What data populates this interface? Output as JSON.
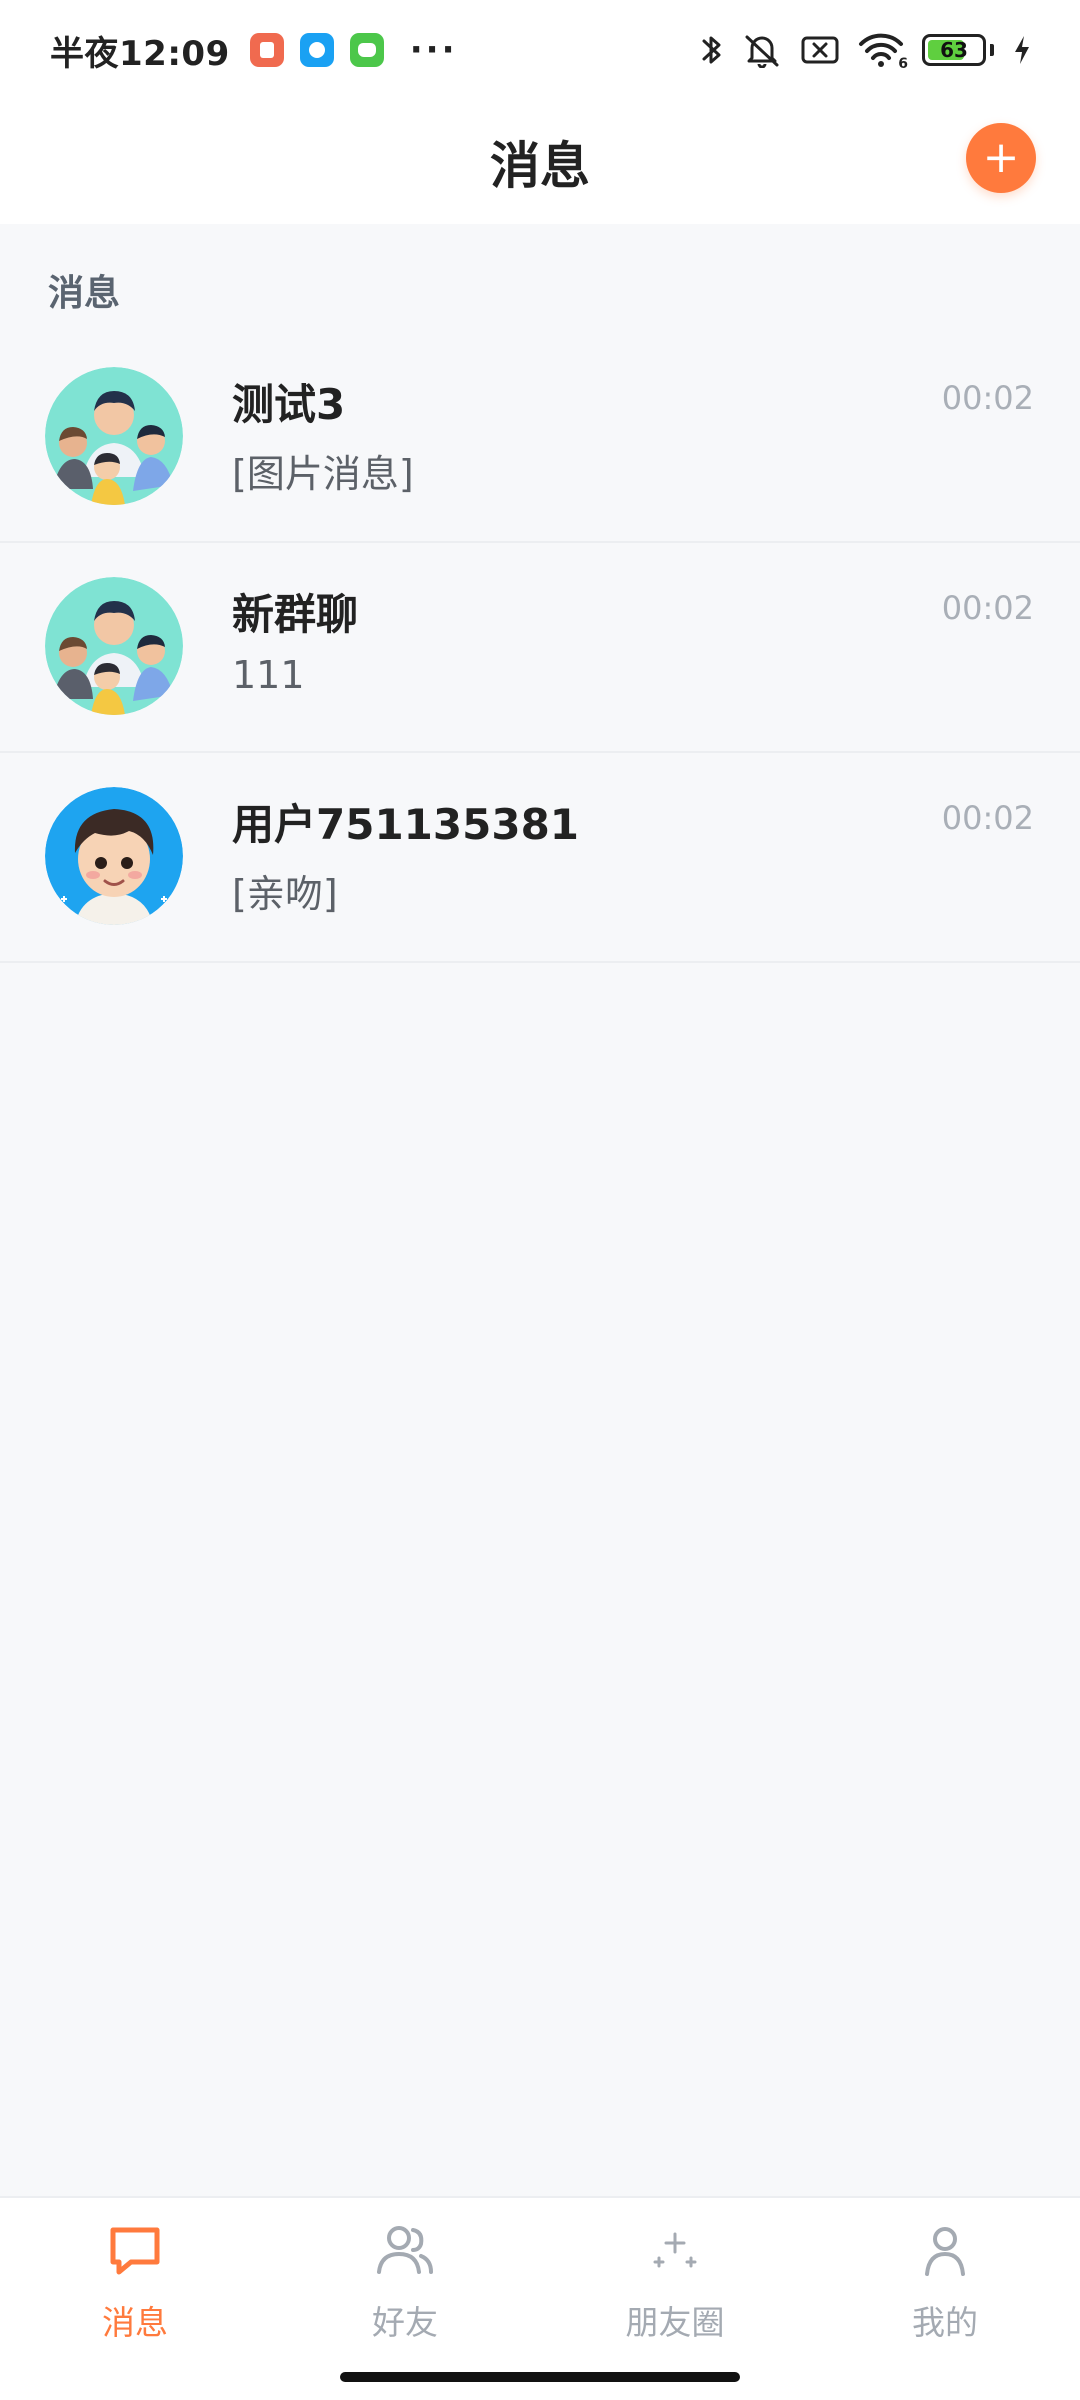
{
  "status_bar": {
    "time": "半夜12:09",
    "more": "···",
    "battery_level": "63",
    "wifi_badge": "6"
  },
  "header": {
    "title": "消息",
    "add_label": "+"
  },
  "section": {
    "label": "消息"
  },
  "conversations": [
    {
      "name": "测试3",
      "preview": "[图片消息]",
      "time": "00:02",
      "avatar_icon": "group-avatar-icon"
    },
    {
      "name": "新群聊",
      "preview": "111",
      "time": "00:02",
      "avatar_icon": "group-avatar-icon"
    },
    {
      "name": "用户751135381",
      "preview": "[亲吻]",
      "time": "00:02",
      "avatar_icon": "user-avatar-icon"
    }
  ],
  "tabbar": {
    "tabs": [
      {
        "label": "消息",
        "icon": "chat-bubble-icon",
        "active": true
      },
      {
        "label": "好友",
        "icon": "friends-icon",
        "active": false
      },
      {
        "label": "朋友圈",
        "icon": "sparkle-icon",
        "active": false
      },
      {
        "label": "我的",
        "icon": "person-icon",
        "active": false
      }
    ]
  },
  "colors": {
    "accent": "#ff7a3d",
    "background": "#f7f8fa",
    "tab_inactive": "#a4aab2"
  }
}
